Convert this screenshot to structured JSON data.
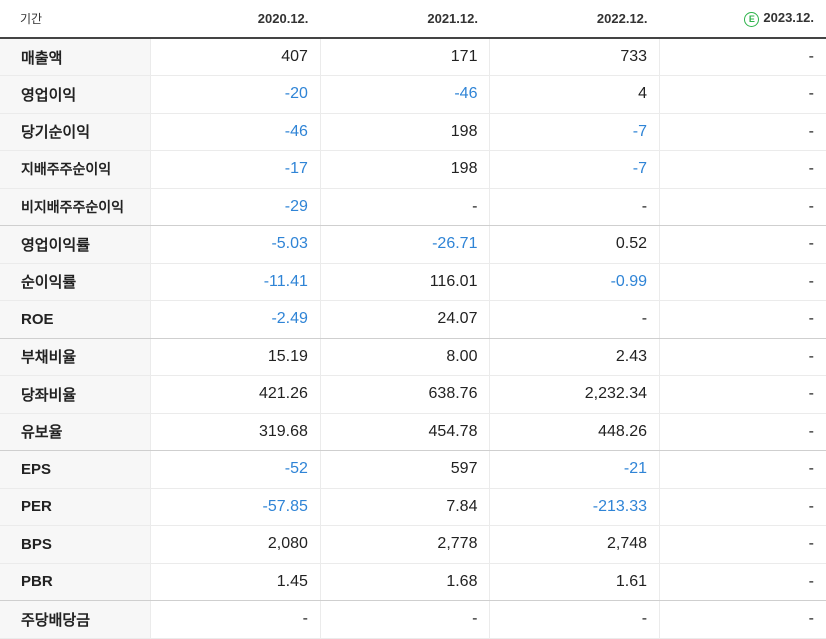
{
  "header": {
    "period_label": "기간",
    "estimate_icon": "E",
    "columns": [
      "2020.12.",
      "2021.12.",
      "2022.12.",
      "2023.12."
    ]
  },
  "colors": {
    "negative": "#2f84d6",
    "estimate_badge": "#2db34a"
  },
  "rows": [
    {
      "label": "매출액",
      "values": [
        "407",
        "171",
        "733",
        "-"
      ]
    },
    {
      "label": "영업이익",
      "values": [
        "-20",
        "-46",
        "4",
        "-"
      ]
    },
    {
      "label": "당기순이익",
      "values": [
        "-46",
        "198",
        "-7",
        "-"
      ]
    },
    {
      "label": "지배주주순이익",
      "values": [
        "-17",
        "198",
        "-7",
        "-"
      ]
    },
    {
      "label": "비지배주주순이익",
      "values": [
        "-29",
        "-",
        "-",
        "-"
      ]
    },
    {
      "label": "영업이익률",
      "values": [
        "-5.03",
        "-26.71",
        "0.52",
        "-"
      ]
    },
    {
      "label": "순이익률",
      "values": [
        "-11.41",
        "116.01",
        "-0.99",
        "-"
      ]
    },
    {
      "label": "ROE",
      "values": [
        "-2.49",
        "24.07",
        "-",
        "-"
      ]
    },
    {
      "label": "부채비율",
      "values": [
        "15.19",
        "8.00",
        "2.43",
        "-"
      ]
    },
    {
      "label": "당좌비율",
      "values": [
        "421.26",
        "638.76",
        "2,232.34",
        "-"
      ]
    },
    {
      "label": "유보율",
      "values": [
        "319.68",
        "454.78",
        "448.26",
        "-"
      ]
    },
    {
      "label": "EPS",
      "values": [
        "-52",
        "597",
        "-21",
        "-"
      ]
    },
    {
      "label": "PER",
      "values": [
        "-57.85",
        "7.84",
        "-213.33",
        "-"
      ]
    },
    {
      "label": "BPS",
      "values": [
        "2,080",
        "2,778",
        "2,748",
        "-"
      ]
    },
    {
      "label": "PBR",
      "values": [
        "1.45",
        "1.68",
        "1.61",
        "-"
      ]
    },
    {
      "label": "주당배당금",
      "values": [
        "-",
        "-",
        "-",
        "-"
      ]
    }
  ]
}
